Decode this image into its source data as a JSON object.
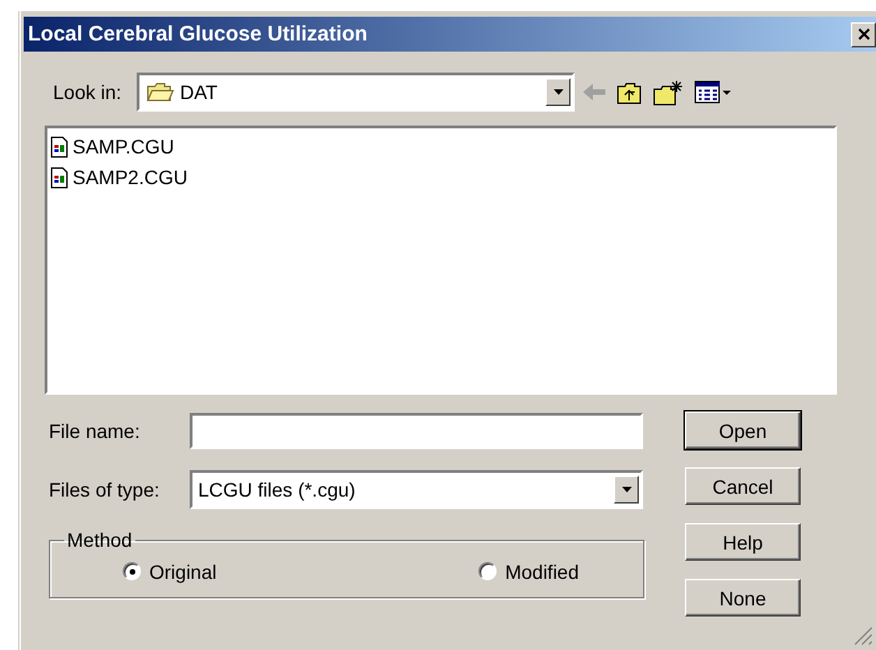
{
  "window": {
    "title": "Local Cerebral Glucose Utilization"
  },
  "look_in": {
    "label": "Look in:",
    "value": "DAT"
  },
  "files": [
    {
      "name": "SAMP.CGU"
    },
    {
      "name": "SAMP2.CGU"
    }
  ],
  "file_name": {
    "label": "File name:"
  },
  "files_of_type": {
    "label": "Files of type:",
    "value": "LCGU files (*.cgu)"
  },
  "method": {
    "label": "Method",
    "options": [
      {
        "label": "Original",
        "selected": true
      },
      {
        "label": "Modified",
        "selected": false
      }
    ]
  },
  "buttons": [
    {
      "label": "Open",
      "default": true
    },
    {
      "label": "Cancel",
      "default": false
    },
    {
      "label": "Help",
      "default": false
    },
    {
      "label": "None",
      "default": false
    }
  ]
}
